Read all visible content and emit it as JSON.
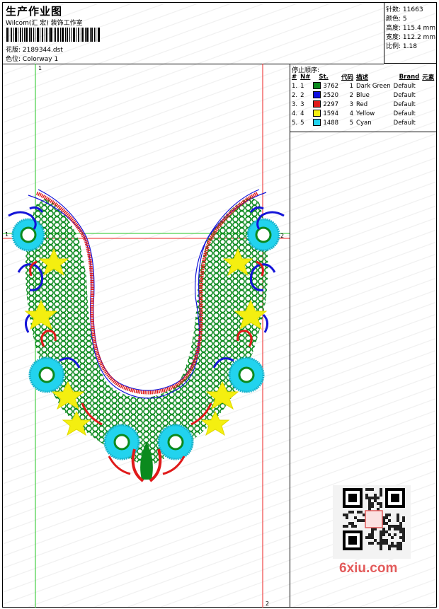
{
  "header": {
    "title": "生产作业图",
    "company": "Wilcom(汇 宏) 装饰工作室",
    "design_label": "花版:",
    "design_value": "2189344.dst",
    "colorway_label": "色位:",
    "colorway_value": "Colorway 1"
  },
  "stats": [
    {
      "label": "针数:",
      "value": "11663"
    },
    {
      "label": "颜色:",
      "value": "5"
    },
    {
      "label": "高度:",
      "value": "115.4 mm"
    },
    {
      "label": "宽度:",
      "value": "112.2 mm"
    },
    {
      "label": "比例:",
      "value": "1.18"
    }
  ],
  "stop_sequence": {
    "title": "停止顺序:",
    "columns": [
      "#",
      "N#",
      "St.",
      "代码",
      "描述",
      "Brand",
      "元素"
    ],
    "rows": [
      {
        "index": "1.",
        "needle": "1",
        "stitches": "3762",
        "code": "1",
        "name": "Dark Green",
        "brand": "Default",
        "color": "#0b8a1e"
      },
      {
        "index": "2.",
        "needle": "2",
        "stitches": "2520",
        "code": "2",
        "name": "Blue",
        "brand": "Default",
        "color": "#1010e0"
      },
      {
        "index": "3.",
        "needle": "3",
        "stitches": "2297",
        "code": "3",
        "name": "Red",
        "brand": "Default",
        "color": "#e01a1a"
      },
      {
        "index": "4.",
        "needle": "4",
        "stitches": "1594",
        "code": "4",
        "name": "Yellow",
        "brand": "Default",
        "color": "#f4ef10"
      },
      {
        "index": "5.",
        "needle": "5",
        "stitches": "1488",
        "code": "5",
        "name": "Cyan",
        "brand": "Default",
        "color": "#22d3ee"
      }
    ]
  },
  "guides": {
    "marker_1": "1",
    "marker_2": "2"
  },
  "watermark": "6xiu.com"
}
